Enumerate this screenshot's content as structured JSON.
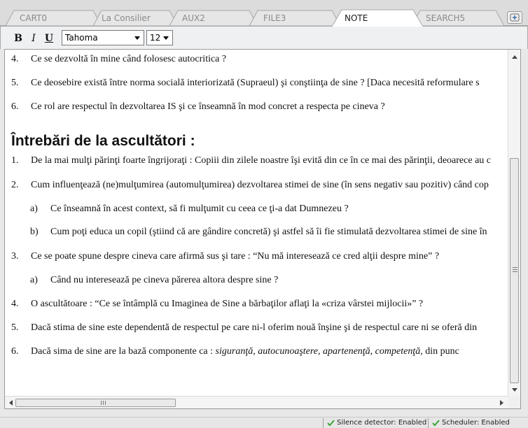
{
  "tabs": [
    {
      "label": "CART0",
      "active": false
    },
    {
      "label": "La Consilier",
      "active": false
    },
    {
      "label": "AUX2",
      "active": false
    },
    {
      "label": "FILE3",
      "active": false
    },
    {
      "label": "NOTE",
      "active": true
    },
    {
      "label": "SEARCH5",
      "active": false
    }
  ],
  "new_tab_icon": "add-tab-icon",
  "toolbar": {
    "bold_label": "B",
    "italic_label": "I",
    "underline_label": "U",
    "font_value": "Tahoma",
    "size_value": "12"
  },
  "document": {
    "top_items": [
      {
        "num": "4.",
        "text": "Ce se dezvoltă în mine când folosesc autocritica ?"
      },
      {
        "num": "5.",
        "text": "Ce deosebire există între norma socială interiorizată (Supraeul) şi conştiinţa de sine ? [Daca necesită reformulare s"
      },
      {
        "num": "6.",
        "text": "Ce rol are respectul în dezvoltarea IS şi ce înseamnă în mod concret a respecta pe cineva ?"
      }
    ],
    "heading": "Întrebări de la ascultători :",
    "q1": {
      "num": "1.",
      "text": "De la mai mulţi părinţi foarte îngrijoraţi : Copiii din zilele noastre îşi evită din ce în ce mai des părinţii, deoarece au c"
    },
    "q2": {
      "num": "2.",
      "text": "Cum influenţează (ne)mulţumirea (automulţumirea) dezvoltarea stimei de sine (în sens negativ sau pozitiv) când cop"
    },
    "q2a": {
      "num": "a)",
      "text": "Ce înseamnă în acest context, să fi mulţumit cu ceea ce ţi-a dat Dumnezeu ?"
    },
    "q2b": {
      "num": "b)",
      "text": "Cum poţi educa un copil (ştiind că are gândire concretă) şi astfel să îi fie stimulată dezvoltarea stimei de sine în"
    },
    "q3": {
      "num": "3.",
      "text": "Ce se poate spune despre cineva care afirmă sus şi tare : “Nu mă interesează ce cred alţii despre mine” ?"
    },
    "q3a": {
      "num": "a)",
      "text": "Când nu interesează pe cineva părerea altora despre sine ?"
    },
    "q4": {
      "num": "4.",
      "text": "O ascultătoare : “Ce se întâmplă cu Imaginea de Sine a bărbaţilor aflaţi la «criza vârstei mijlocii»” ?"
    },
    "q5": {
      "num": "5.",
      "text": "Dacă stima de sine este dependentă de respectul pe care ni-l oferim nouă înşine şi de respectul care ni se oferă din"
    },
    "q6": {
      "num": "6.",
      "text_prefix": "Dacă sima de sine are la bază componente ca : ",
      "text_italic": "siguranţă, autocunoaştere, apartenenţă, competenţă,",
      "text_suffix": " din punc"
    }
  },
  "hscroll_grip": "III",
  "status": {
    "silence": "Silence detector: Enabled",
    "scheduler": "Scheduler: Enabled"
  },
  "colors": {
    "status_ok": "#3aa63a",
    "tab_active_bg": "#ffffff",
    "tab_inactive_bg": "#e4e4e4"
  }
}
